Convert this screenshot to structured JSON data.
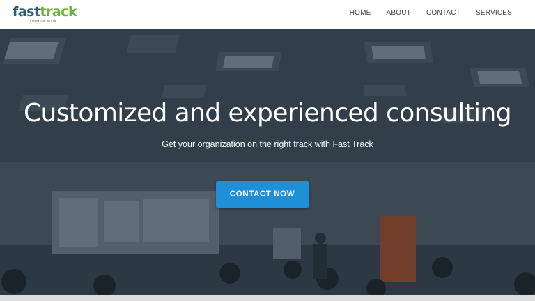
{
  "brand": {
    "word_fast": "fast",
    "word_track": "track",
    "tagline": "COMMUNICATION"
  },
  "nav": {
    "items": [
      {
        "label": "HOME"
      },
      {
        "label": "ABOUT"
      },
      {
        "label": "CONTACT"
      },
      {
        "label": "SERVICES"
      }
    ]
  },
  "hero": {
    "headline": "Customized and experienced consulting",
    "subline": "Get your organization on the right track with Fast Track",
    "cta_label": "CONTACT NOW"
  },
  "colors": {
    "brand_blue": "#2b5d7a",
    "brand_green": "#6fb03a",
    "cta_blue": "#1f8fd8"
  }
}
